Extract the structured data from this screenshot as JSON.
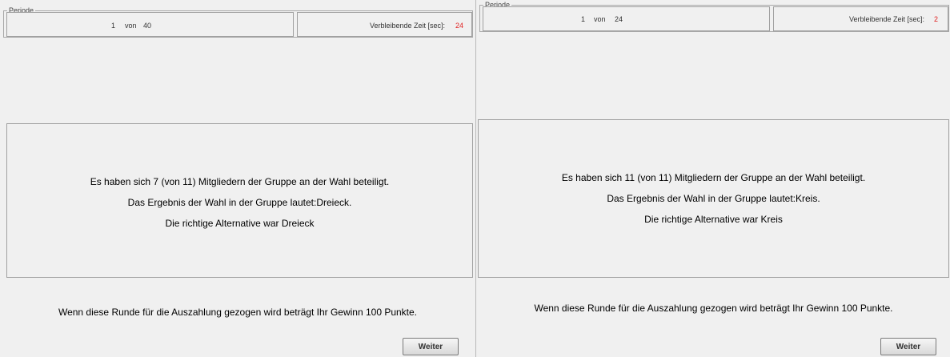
{
  "screens": [
    {
      "period_label": "Periode",
      "period_current": "1",
      "period_of": "von",
      "period_total": "40",
      "time_label": "Verbleibende Zeit [sec]:",
      "time_value": "24",
      "result_lines": [
        "Es haben sich 7 (von 11) Mitgliedern der Gruppe an der Wahl beteiligt.",
        "Das Ergebnis der Wahl in der Gruppe lautet:Dreieck.",
        "Die richtige Alternative war Dreieck"
      ],
      "payout_text": "Wenn diese Runde für die Auszahlung gezogen wird beträgt Ihr Gewinn  100 Punkte.",
      "continue_label": "Weiter"
    },
    {
      "period_label": "Periode",
      "period_current": "1",
      "period_of": "von",
      "period_total": "24",
      "time_label": "Verbleibende Zeit [sec]:",
      "time_value": "2",
      "result_lines": [
        "Es haben sich 11 (von 11) Mitgliedern der Gruppe an der Wahl beteiligt.",
        "Das Ergebnis der Wahl in der Gruppe lautet:Kreis.",
        "Die richtige Alternative war Kreis"
      ],
      "payout_text": "Wenn diese Runde für die Auszahlung gezogen wird beträgt Ihr Gewinn  100 Punkte.",
      "continue_label": "Weiter"
    }
  ]
}
